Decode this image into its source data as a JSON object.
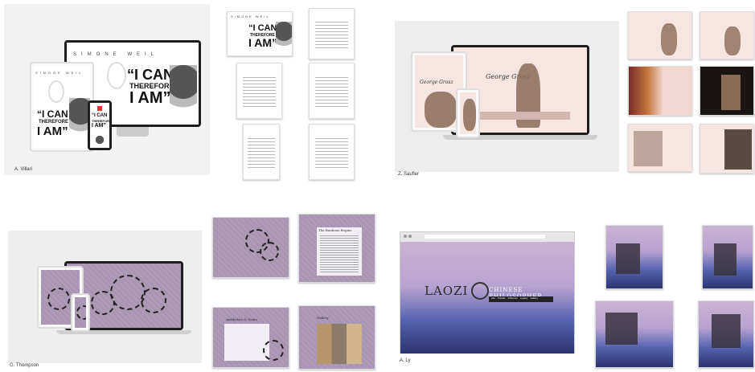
{
  "captions": {
    "villari": "A. Villari",
    "saufler": "Z. Saufler",
    "thompson": "G. Thompson",
    "ly": "A. Ly"
  },
  "villari": {
    "brand": "SIMONE WEIL",
    "quote_line1": "“I CAN",
    "quote_line2": "THEREFORE",
    "quote_line3": "I AM”"
  },
  "saufler": {
    "title": "George Grosz"
  },
  "thompson": {
    "page1_title": "The Bauhaus Begins",
    "page2_title": "Aesthetics & Gears",
    "page3_title": "Gallery"
  },
  "ly": {
    "title": "LAOZI",
    "subtitle": "CHINESE PHILOSOPHER",
    "nav": [
      "Life",
      "Travels",
      "Influence",
      "Legacy",
      "Gallery"
    ]
  },
  "colors": {
    "purple": "#a894b3",
    "mountain_dark": "#2b3470",
    "pale_pink": "#f7e5e1"
  }
}
